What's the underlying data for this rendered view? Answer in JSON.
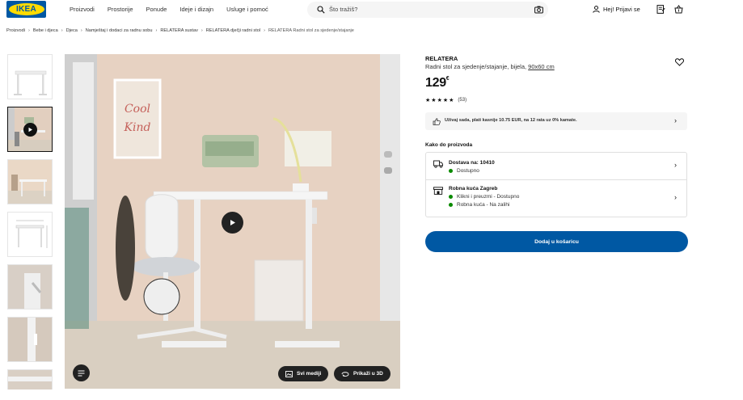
{
  "header": {
    "logo_text": "IKEA",
    "nav": [
      "Proizvodi",
      "Prostorije",
      "Ponude",
      "Ideje i dizajn",
      "Usluge i pomoć"
    ],
    "search_placeholder": "Što tražiš?",
    "login_label": "Hej! Prijavi se",
    "icons": [
      "search-icon",
      "camera-icon",
      "user-icon",
      "shopping-list-icon",
      "cart-icon"
    ]
  },
  "breadcrumb": [
    "Proizvodi",
    "Bebe i djeca",
    "Djeca",
    "Namještaj i dodaci za radnu sobu",
    "RELATERA sustav",
    "RELATERA dječji radni stol",
    "RELATERA Radni stol za sjedenje/stajanje"
  ],
  "gallery": {
    "media_button": "Svi mediji",
    "view_3d_button": "Prikaži u 3D"
  },
  "product": {
    "name": "RELATERA",
    "description": "Radni stol za sjedenje/stajanje, bijela,",
    "size": "90x60 cm",
    "price": "129",
    "currency": "€",
    "rating_stars": 5,
    "review_count": "(53)",
    "promo_text": "Uživaj sada, plati kasnije 10.75 EUR, na 12 rata uz 0% kamate."
  },
  "delivery": {
    "section_title": "Kako do proizvoda",
    "delivery_title": "Dostava na: 10410",
    "delivery_status": "Dostupno",
    "store_title": "Robna kuća Zagreb",
    "store_status_1": "Klikni i preuzmi - Dostupno",
    "store_status_2": "Robna kuća - Na zalihi"
  },
  "cart_button": "Dodaj u košaricu",
  "colors": {
    "brand_blue": "#0058a3",
    "brand_yellow": "#ffdb00",
    "available_green": "#0a8a00"
  }
}
